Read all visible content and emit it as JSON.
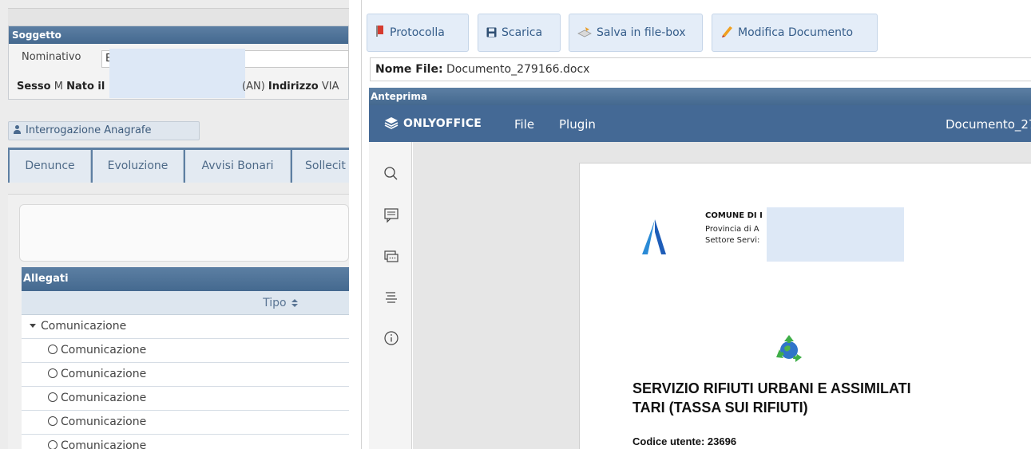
{
  "left": {
    "soggetto": {
      "header": "Soggetto",
      "nominativo_label": "Nominativo",
      "nominativo_value": "B",
      "sesso_label": "Sesso",
      "sesso_value": "M",
      "nato_label": "Nato il",
      "provincia": "(AN)",
      "indirizzo_label": "Indirizzo",
      "indirizzo_value": "VIA"
    },
    "interrogazione_label": "Interrogazione Anagrafe",
    "tabs": [
      {
        "label": "Denunce"
      },
      {
        "label": "Evoluzione"
      },
      {
        "label": "Avvisi Bonari"
      },
      {
        "label": "Sollecit"
      }
    ],
    "allegati": {
      "header": "Allegati",
      "column_tipo": "Tipo",
      "group_label": "Comunicazione",
      "items": [
        "Comunicazione",
        "Comunicazione",
        "Comunicazione",
        "Comunicazione",
        "Comunicazione"
      ]
    }
  },
  "toolbar": {
    "protocolla": "Protocolla",
    "scarica": "Scarica",
    "salva": "Salva in file-box",
    "modifica": "Modifica Documento"
  },
  "file": {
    "nome_label": "Nome File:",
    "nome_value": "Documento_279166.docx"
  },
  "preview": {
    "header": "Anteprima",
    "onlyoffice": {
      "logo": "ONLYOFFICE",
      "menu_file": "File",
      "menu_plugin": "Plugin",
      "doc_title": "Documento_27",
      "side_icons": [
        "search-icon",
        "comment-icon",
        "chat-icon",
        "headings-icon",
        "info-icon"
      ]
    },
    "document": {
      "comune": "COMUNE DI I",
      "provincia": "Provincia di A",
      "settore": "Settore Servi:",
      "title_line1": "SERVIZIO RIFIUTI URBANI E ASSIMILATI",
      "title_line2": "TARI (TASSA SUI RIFIUTI)",
      "codice_utente": "Codice utente: 23696"
    }
  },
  "colors": {
    "header_blue": "#4f7398",
    "onlyoffice_bar": "#446995",
    "button_bg": "#e4edf8",
    "redaction": "#dde8f6"
  }
}
